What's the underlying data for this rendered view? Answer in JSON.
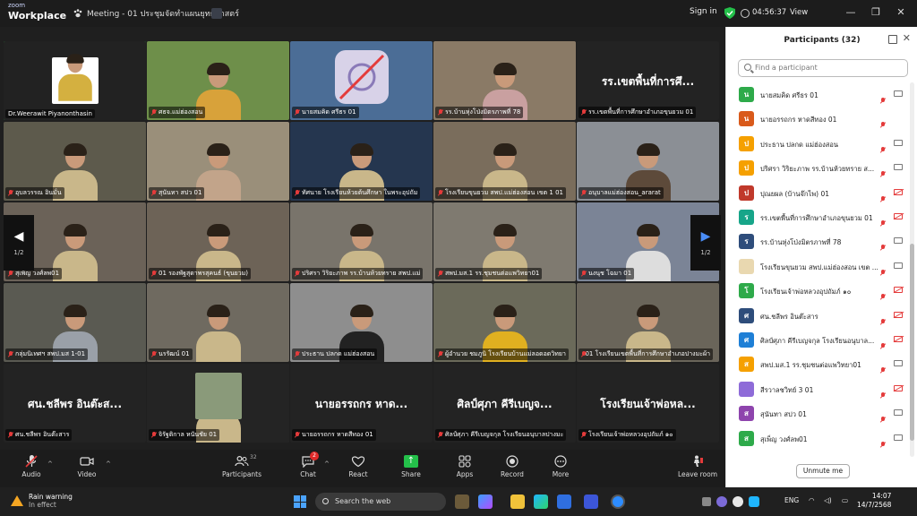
{
  "titlebar": {
    "logo_line1": "zoom",
    "logo_line2": "Workplace",
    "meeting_title": "Meeting - 01 ประชุมจัดทำแผนยุทธศาสตร์",
    "sign_in": "Sign in",
    "timer": "04:56:37",
    "view": "View"
  },
  "gallery": {
    "page_left": "1/2",
    "page_right": "1/2",
    "tiles": [
      {
        "name": "Dr.Weerawit Piyanonthasin",
        "muted": false
      },
      {
        "name": "ศธจ.แม่ฮ่องสอน",
        "muted": true
      },
      {
        "name": "นายสมคิด ศรีธร 01",
        "muted": true
      },
      {
        "name": "รร.บ้านหุ่งโป่งมิตรภาพที่ 78",
        "muted": true
      },
      {
        "name": "รร.เขตพื้นที่การศึกษาอำเภอขุนยวม 01",
        "muted": true,
        "big": "รร.เขตพื้นที่การศึ..."
      },
      {
        "name": "อุบลวรรณ อินมั่น",
        "muted": true
      },
      {
        "name": "สุนันทา สปว 01",
        "muted": true
      },
      {
        "name": "ทัศนาย โรงเรียนห้วยต้นศึกษา ในพระอุปถัม",
        "muted": true
      },
      {
        "name": "โรงเรียนขุนยวม สพป.แม่ฮ่องสอน เขต 1 01",
        "muted": true
      },
      {
        "name": "อนุบาลแม่ฮ่องสอน_ararat",
        "muted": true
      },
      {
        "name": "สุเพ็ญ วงศ์ลพ01",
        "muted": true
      },
      {
        "name": "01 รองพัฐสุดาพรสุคนธ์ (ขุนยวม)",
        "muted": true
      },
      {
        "name": "ปริศรา วิริยะภาพ รร.บ้านห้วยทราย สพป.แม่",
        "muted": true
      },
      {
        "name": "สพป.มส.1 รร.ชุมชนต่อแพวิทยา01",
        "muted": true
      },
      {
        "name": "นงนุช โฉมา 01",
        "muted": true
      },
      {
        "name": "กลุ่มนิเทศฯ สพป.มส 1-01",
        "muted": true
      },
      {
        "name": "นรรัฒน์ 01",
        "muted": true
      },
      {
        "name": "ประธาน ปลกด แม่ฮ่องสอน",
        "muted": true
      },
      {
        "name": "ผู้อำนวย ชมภูนิ โรงเรียนบ้านแม่ลอดอดวิทยา",
        "muted": true
      },
      {
        "name": "01 โรงเรียนเขตพื้นที่การศึกษาอำเภอปางมะผ้า",
        "muted": true
      },
      {
        "name": "ศน.ชลีพร อินต๊ะสาร",
        "muted": true,
        "big": "ศน.ชลีพร อินต๊ะส..."
      },
      {
        "name": "จิรัฐติกาล หนันชัย 01",
        "muted": true
      },
      {
        "name": "นายอรรถกร หาดสีทอง 01",
        "muted": true,
        "big": "นายอรรถกร หาด..."
      },
      {
        "name": "ศิลป์ศุภา คีรีเบญจกุล โรงเรียนอนุบาลปางมะ",
        "muted": true,
        "big": "ศิลป์ศุภา คีรีเบญจ..."
      },
      {
        "name": "โรงเรียนเจ้าพ่อหลวงอุปถัมภ์ ๑๐",
        "muted": true,
        "big": "โรงเรียนเจ้าพ่อหล..."
      }
    ]
  },
  "toolbar": {
    "audio": "Audio",
    "video": "Video",
    "participants": "Participants",
    "participants_count": "32",
    "chat": "Chat",
    "chat_badge": "2",
    "react": "React",
    "share": "Share",
    "apps": "Apps",
    "record": "Record",
    "more": "More",
    "leave": "Leave room"
  },
  "panel": {
    "title": "Participants (32)",
    "search_placeholder": "Find a participant",
    "unmute_me": "Unmute me",
    "participants": [
      {
        "initial": "น",
        "name": "นายสมคิด ศรีธร 01",
        "color": "#2eaa4a",
        "cam_off": false
      },
      {
        "initial": "น",
        "name": "นายอรรถกร หาดสีทอง 01",
        "color": "#d95a1b",
        "cam_off": null
      },
      {
        "initial": "ป",
        "name": "ประธาน ปลกด แม่ฮ่องสอน",
        "color": "#f5a000",
        "cam_off": false
      },
      {
        "initial": "ป",
        "name": "ปริศรา วิริยะภาพ รร.บ้านห้วยทราย ส...",
        "color": "#f5a000",
        "cam_off": false
      },
      {
        "initial": "ป",
        "name": "ปุณยผล (บ้านจ๊กไพ) 01",
        "color": "#c0392b",
        "cam_off": true
      },
      {
        "initial": "ร",
        "name": "รร.เขตพื้นที่การศึกษาอำเภอขุนยวม 01",
        "color": "#17a589",
        "cam_off": true
      },
      {
        "initial": "ร",
        "name": "รร.บ้านหุ่งโป่งมิตรภาพที่ 78",
        "color": "#2e4d7b",
        "cam_off": false
      },
      {
        "initial": "",
        "name": "โรงเรียนขุนยวม สพป.แม่ฮ่องสอน เขต ...",
        "color": "#e9d8b0",
        "cam_off": false
      },
      {
        "initial": "โ",
        "name": "โรงเรียนเจ้าพ่อหลวงอุปถัมภ์ ๑๐",
        "color": "#2eaa4a",
        "cam_off": true
      },
      {
        "initial": "ศ",
        "name": "ศน.ชลีพร อินต๊ะสาร",
        "color": "#2e4d7b",
        "cam_off": true
      },
      {
        "initial": "ศ",
        "name": "ศิลป์ศุภา คีรีเบญจกุล โรงเรียนอนุบาล...",
        "color": "#1e7fd6",
        "cam_off": true
      },
      {
        "initial": "ส",
        "name": "สพป.มส.1 รร.ชุมชนต่อแพวิทยา01",
        "color": "#f5a000",
        "cam_off": false
      },
      {
        "initial": "",
        "name": "สีรวาลชวิทย์ 3 01",
        "color": "#8e6bd8",
        "cam_off": true
      },
      {
        "initial": "ส",
        "name": "สุนันทา สปว 01",
        "color": "#8e44ad",
        "cam_off": false
      },
      {
        "initial": "ส",
        "name": "สุเพ็ญ วงศ์ลพ01",
        "color": "#2eaa4a",
        "cam_off": false
      }
    ]
  },
  "taskbar": {
    "weather_title": "Rain warning",
    "weather_sub": "In effect",
    "search_placeholder": "Search the web",
    "lang": "ENG",
    "time": "14:07",
    "date": "14/7/2568"
  },
  "colors": {
    "active_speaker": "#24c04a",
    "muted_red": "#e43b3b",
    "accent_blue": "#4a8df6"
  }
}
